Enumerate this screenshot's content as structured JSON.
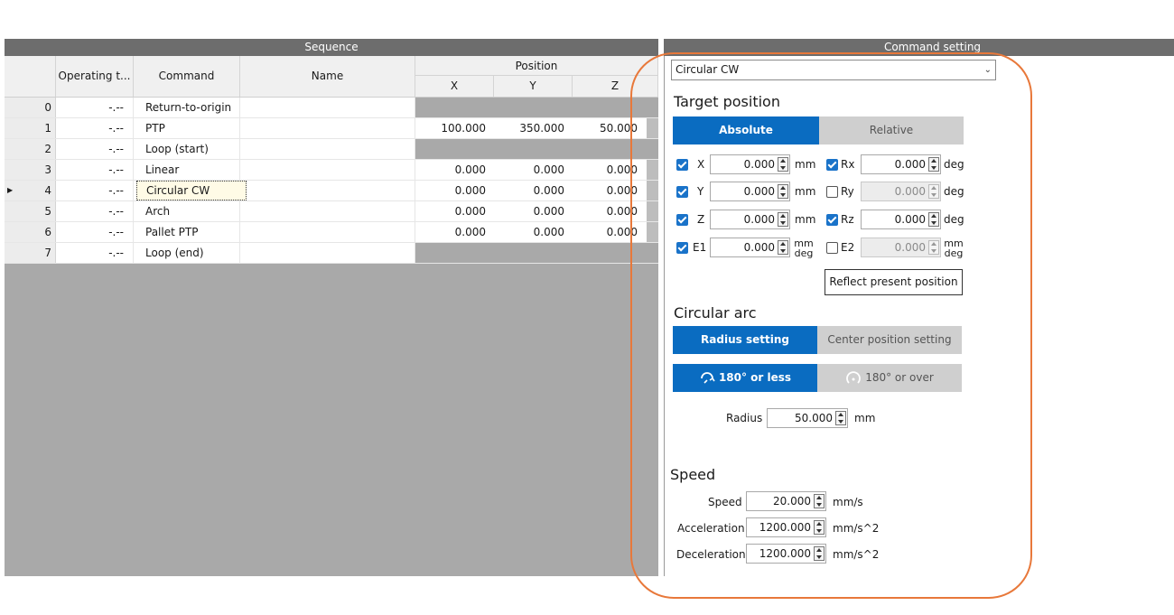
{
  "sequence": {
    "title": "Sequence",
    "headers": {
      "operating_time": "Operating t...",
      "command": "Command",
      "name": "Name",
      "position": "Position",
      "x": "X",
      "y": "Y",
      "z": "Z"
    },
    "rows": [
      {
        "index": "0",
        "op": "-.--",
        "command": "Return-to-origin",
        "name": "",
        "x": "",
        "y": "",
        "z": "",
        "has_position": false,
        "selected": false
      },
      {
        "index": "1",
        "op": "-.--",
        "command": "PTP",
        "name": "",
        "x": "100.000",
        "y": "350.000",
        "z": "50.000",
        "has_position": true,
        "selected": false
      },
      {
        "index": "2",
        "op": "-.--",
        "command": "Loop (start)",
        "name": "",
        "x": "",
        "y": "",
        "z": "",
        "has_position": false,
        "selected": false
      },
      {
        "index": "3",
        "op": "-.--",
        "command": "Linear",
        "name": "",
        "x": "0.000",
        "y": "0.000",
        "z": "0.000",
        "has_position": true,
        "selected": false
      },
      {
        "index": "4",
        "op": "-.--",
        "command": "Circular CW",
        "name": "",
        "x": "0.000",
        "y": "0.000",
        "z": "0.000",
        "has_position": true,
        "selected": true
      },
      {
        "index": "5",
        "op": "-.--",
        "command": "Arch",
        "name": "",
        "x": "0.000",
        "y": "0.000",
        "z": "0.000",
        "has_position": true,
        "selected": false
      },
      {
        "index": "6",
        "op": "-.--",
        "command": "Pallet PTP",
        "name": "",
        "x": "0.000",
        "y": "0.000",
        "z": "0.000",
        "has_position": true,
        "selected": false
      },
      {
        "index": "7",
        "op": "-.--",
        "command": "Loop (end)",
        "name": "",
        "x": "",
        "y": "",
        "z": "",
        "has_position": false,
        "selected": false
      }
    ],
    "current_row_marker": "▶"
  },
  "command_setting": {
    "title": "Command setting",
    "command_select": {
      "value": "Circular CW",
      "arrow": "⌄"
    },
    "target_position": {
      "label": "Target position",
      "absolute": "Absolute",
      "relative": "Relative",
      "fields": {
        "x": {
          "label": "X",
          "value": "0.000",
          "unit": "mm",
          "checked": true
        },
        "y": {
          "label": "Y",
          "value": "0.000",
          "unit": "mm",
          "checked": true
        },
        "z": {
          "label": "Z",
          "value": "0.000",
          "unit": "mm",
          "checked": true
        },
        "e1": {
          "label": "E1",
          "value": "0.000",
          "unit_top": "mm",
          "unit_bottom": "deg",
          "checked": true
        },
        "rx": {
          "label": "Rx",
          "value": "0.000",
          "unit": "deg",
          "checked": true
        },
        "ry": {
          "label": "Ry",
          "value": "0.000",
          "unit": "deg",
          "checked": false
        },
        "rz": {
          "label": "Rz",
          "value": "0.000",
          "unit": "deg",
          "checked": true
        },
        "e2": {
          "label": "E2",
          "value": "0.000",
          "unit_top": "mm",
          "unit_bottom": "deg",
          "checked": false
        }
      },
      "reflect_button": "Reflect present position"
    },
    "circular_arc": {
      "label": "Circular arc",
      "radius_setting": "Radius setting",
      "center_position_setting": "Center position setting",
      "le180": "180° or less",
      "ge180": "180° or over",
      "radius_label": "Radius",
      "radius_value": "50.000",
      "radius_unit": "mm"
    },
    "speed": {
      "label": "Speed",
      "speed_label": "Speed",
      "speed_value": "20.000",
      "speed_unit": "mm/s",
      "acc_label": "Acceleration",
      "acc_value": "1200.000",
      "acc_unit": "mm/s^2",
      "dec_label": "Deceleration",
      "dec_value": "1200.000",
      "dec_unit": "mm/s^2"
    }
  },
  "colors": {
    "accent": "#0a6cc1",
    "highlight_outline": "#e8783a",
    "panel_header": "#6d6d6d",
    "empty_area": "#a9a9a9"
  }
}
